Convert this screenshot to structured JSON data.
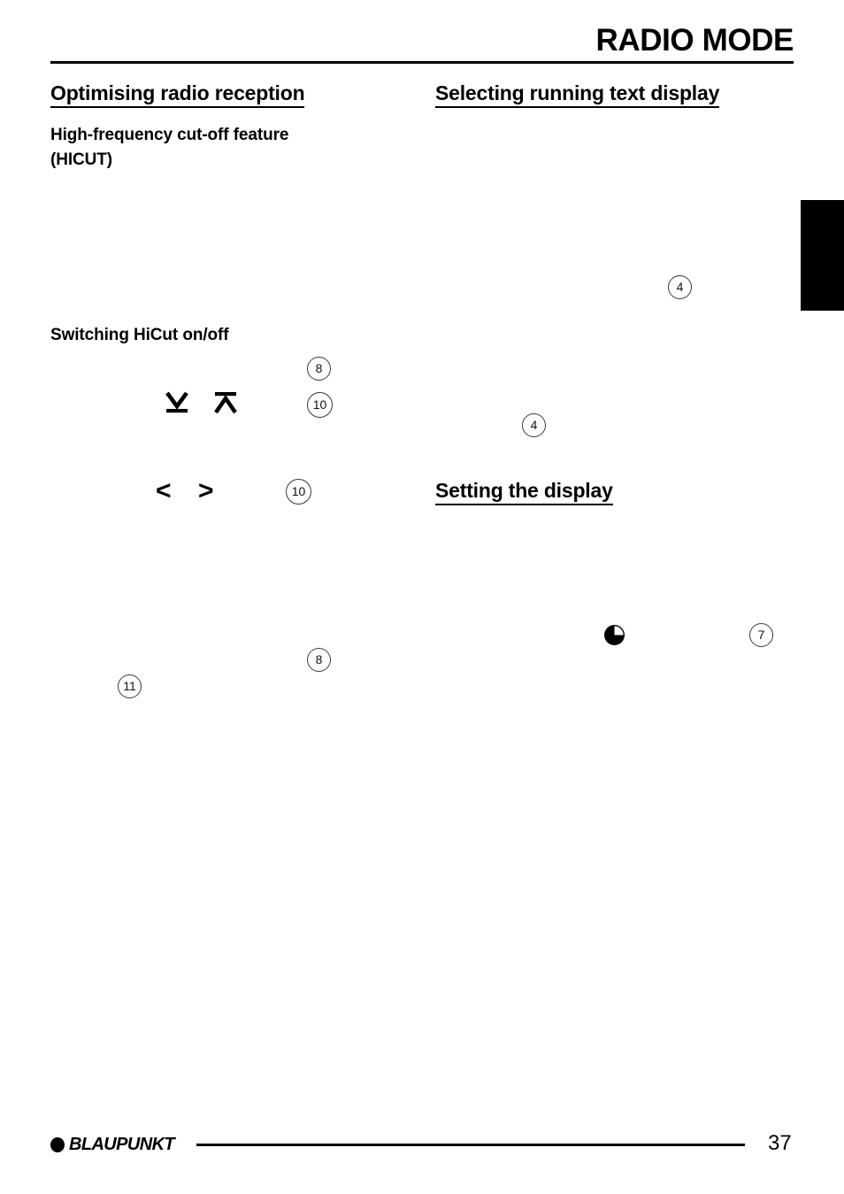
{
  "document": {
    "header_title": "RADIO MODE",
    "page_number": "37",
    "footer_brand": "BLAUPUNKT"
  },
  "left_column": {
    "section_heading": "Optimising radio reception",
    "subheading_1_line1": "High-frequency cut-off feature",
    "subheading_1_line2": "(HICUT)",
    "subheading_2": "Switching HiCut on/off",
    "callouts": [
      {
        "id": "left-callout-8a",
        "label": "8"
      },
      {
        "id": "left-callout-10a",
        "label": "10"
      },
      {
        "id": "left-callout-10b",
        "label": "10"
      },
      {
        "id": "left-callout-8b",
        "label": "8"
      },
      {
        "id": "left-callout-11",
        "label": "11"
      }
    ],
    "symbols": [
      {
        "id": "seek-down-button-symbol",
        "name": "arrow-down-with-bar-icon"
      },
      {
        "id": "seek-up-button-symbol",
        "name": "arrow-up-with-bar-icon"
      },
      {
        "id": "left-chevron-button-symbol",
        "name": "chevron-left-icon",
        "glyph": "<"
      },
      {
        "id": "right-chevron-button-symbol",
        "name": "chevron-right-icon",
        "glyph": ">"
      }
    ]
  },
  "right_column": {
    "section_heading": "Selecting running text display",
    "section_heading_2": "Setting the display",
    "callouts": [
      {
        "id": "right-callout-4a",
        "label": "4"
      },
      {
        "id": "right-callout-4b",
        "label": "4"
      },
      {
        "id": "right-callout-7",
        "label": "7"
      }
    ],
    "symbols": [
      {
        "id": "clock-button-symbol",
        "name": "clock-icon"
      }
    ]
  }
}
